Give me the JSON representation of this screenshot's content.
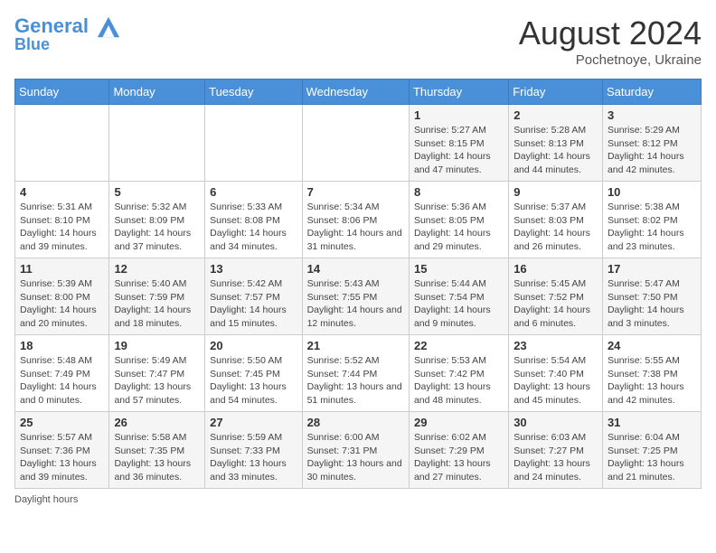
{
  "header": {
    "logo_line1": "General",
    "logo_line2": "Blue",
    "month_year": "August 2024",
    "location": "Pochetnoye, Ukraine"
  },
  "days_of_week": [
    "Sunday",
    "Monday",
    "Tuesday",
    "Wednesday",
    "Thursday",
    "Friday",
    "Saturday"
  ],
  "weeks": [
    [
      {
        "day": "",
        "sunrise": "",
        "sunset": "",
        "daylight": ""
      },
      {
        "day": "",
        "sunrise": "",
        "sunset": "",
        "daylight": ""
      },
      {
        "day": "",
        "sunrise": "",
        "sunset": "",
        "daylight": ""
      },
      {
        "day": "",
        "sunrise": "",
        "sunset": "",
        "daylight": ""
      },
      {
        "day": "1",
        "sunrise": "5:27 AM",
        "sunset": "8:15 PM",
        "daylight": "14 hours and 47 minutes."
      },
      {
        "day": "2",
        "sunrise": "5:28 AM",
        "sunset": "8:13 PM",
        "daylight": "14 hours and 44 minutes."
      },
      {
        "day": "3",
        "sunrise": "5:29 AM",
        "sunset": "8:12 PM",
        "daylight": "14 hours and 42 minutes."
      }
    ],
    [
      {
        "day": "4",
        "sunrise": "5:31 AM",
        "sunset": "8:10 PM",
        "daylight": "14 hours and 39 minutes."
      },
      {
        "day": "5",
        "sunrise": "5:32 AM",
        "sunset": "8:09 PM",
        "daylight": "14 hours and 37 minutes."
      },
      {
        "day": "6",
        "sunrise": "5:33 AM",
        "sunset": "8:08 PM",
        "daylight": "14 hours and 34 minutes."
      },
      {
        "day": "7",
        "sunrise": "5:34 AM",
        "sunset": "8:06 PM",
        "daylight": "14 hours and 31 minutes."
      },
      {
        "day": "8",
        "sunrise": "5:36 AM",
        "sunset": "8:05 PM",
        "daylight": "14 hours and 29 minutes."
      },
      {
        "day": "9",
        "sunrise": "5:37 AM",
        "sunset": "8:03 PM",
        "daylight": "14 hours and 26 minutes."
      },
      {
        "day": "10",
        "sunrise": "5:38 AM",
        "sunset": "8:02 PM",
        "daylight": "14 hours and 23 minutes."
      }
    ],
    [
      {
        "day": "11",
        "sunrise": "5:39 AM",
        "sunset": "8:00 PM",
        "daylight": "14 hours and 20 minutes."
      },
      {
        "day": "12",
        "sunrise": "5:40 AM",
        "sunset": "7:59 PM",
        "daylight": "14 hours and 18 minutes."
      },
      {
        "day": "13",
        "sunrise": "5:42 AM",
        "sunset": "7:57 PM",
        "daylight": "14 hours and 15 minutes."
      },
      {
        "day": "14",
        "sunrise": "5:43 AM",
        "sunset": "7:55 PM",
        "daylight": "14 hours and 12 minutes."
      },
      {
        "day": "15",
        "sunrise": "5:44 AM",
        "sunset": "7:54 PM",
        "daylight": "14 hours and 9 minutes."
      },
      {
        "day": "16",
        "sunrise": "5:45 AM",
        "sunset": "7:52 PM",
        "daylight": "14 hours and 6 minutes."
      },
      {
        "day": "17",
        "sunrise": "5:47 AM",
        "sunset": "7:50 PM",
        "daylight": "14 hours and 3 minutes."
      }
    ],
    [
      {
        "day": "18",
        "sunrise": "5:48 AM",
        "sunset": "7:49 PM",
        "daylight": "14 hours and 0 minutes."
      },
      {
        "day": "19",
        "sunrise": "5:49 AM",
        "sunset": "7:47 PM",
        "daylight": "13 hours and 57 minutes."
      },
      {
        "day": "20",
        "sunrise": "5:50 AM",
        "sunset": "7:45 PM",
        "daylight": "13 hours and 54 minutes."
      },
      {
        "day": "21",
        "sunrise": "5:52 AM",
        "sunset": "7:44 PM",
        "daylight": "13 hours and 51 minutes."
      },
      {
        "day": "22",
        "sunrise": "5:53 AM",
        "sunset": "7:42 PM",
        "daylight": "13 hours and 48 minutes."
      },
      {
        "day": "23",
        "sunrise": "5:54 AM",
        "sunset": "7:40 PM",
        "daylight": "13 hours and 45 minutes."
      },
      {
        "day": "24",
        "sunrise": "5:55 AM",
        "sunset": "7:38 PM",
        "daylight": "13 hours and 42 minutes."
      }
    ],
    [
      {
        "day": "25",
        "sunrise": "5:57 AM",
        "sunset": "7:36 PM",
        "daylight": "13 hours and 39 minutes."
      },
      {
        "day": "26",
        "sunrise": "5:58 AM",
        "sunset": "7:35 PM",
        "daylight": "13 hours and 36 minutes."
      },
      {
        "day": "27",
        "sunrise": "5:59 AM",
        "sunset": "7:33 PM",
        "daylight": "13 hours and 33 minutes."
      },
      {
        "day": "28",
        "sunrise": "6:00 AM",
        "sunset": "7:31 PM",
        "daylight": "13 hours and 30 minutes."
      },
      {
        "day": "29",
        "sunrise": "6:02 AM",
        "sunset": "7:29 PM",
        "daylight": "13 hours and 27 minutes."
      },
      {
        "day": "30",
        "sunrise": "6:03 AM",
        "sunset": "7:27 PM",
        "daylight": "13 hours and 24 minutes."
      },
      {
        "day": "31",
        "sunrise": "6:04 AM",
        "sunset": "7:25 PM",
        "daylight": "13 hours and 21 minutes."
      }
    ]
  ],
  "footer": {
    "daylight_label": "Daylight hours"
  }
}
